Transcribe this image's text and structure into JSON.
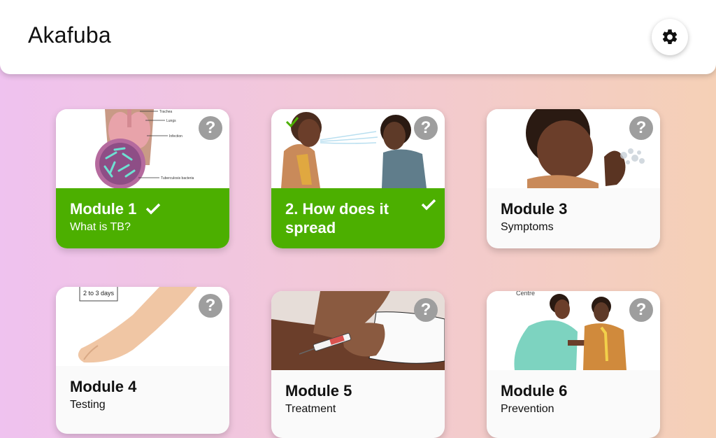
{
  "header": {
    "title": "Akafuba",
    "settings_icon": "gear-icon"
  },
  "modules": [
    {
      "title": "Module 1",
      "subtitle": "What is TB?",
      "completed": true,
      "help": "?"
    },
    {
      "title": "2. How does it spread",
      "subtitle": "",
      "completed": true,
      "help": "?"
    },
    {
      "title": "Module 3",
      "subtitle": "Symptoms",
      "completed": false,
      "help": "?"
    },
    {
      "title": "Module 4",
      "subtitle": "Testing",
      "completed": false,
      "help": "?"
    },
    {
      "title": "Module 5",
      "subtitle": "Treatment",
      "completed": false,
      "help": "?"
    },
    {
      "title": "Module 6",
      "subtitle": "Prevention",
      "completed": false,
      "help": "?"
    }
  ],
  "illustration_labels": {
    "lungs_diagram": [
      "Trachea",
      "Lungs",
      "Infection",
      "Tuberculosis bacteria"
    ],
    "testing_note": "2 to 3 days",
    "clinic_sign": "Centre"
  },
  "colors": {
    "completed": "#4caf00",
    "help_badge": "#9e9e9e"
  }
}
